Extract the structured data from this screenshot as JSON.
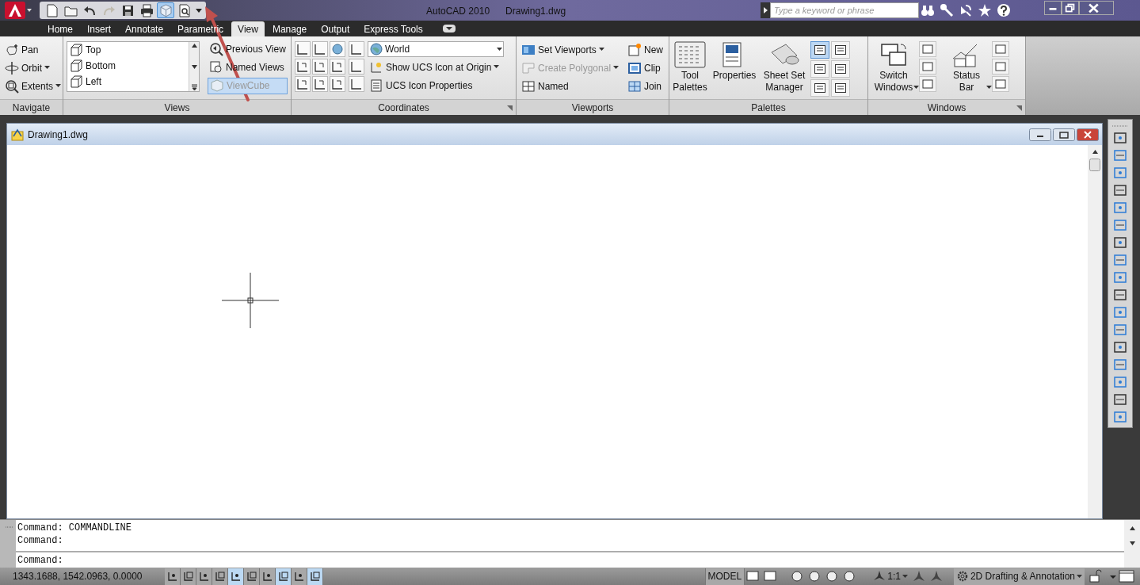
{
  "title_bar": {
    "app_title": "AutoCAD 2010",
    "document": "Drawing1.dwg",
    "search": {
      "placeholder": "Type a keyword or phrase"
    }
  },
  "quick_access": [
    {
      "kind": "new",
      "selected": false,
      "disabled": false
    },
    {
      "kind": "open",
      "selected": false,
      "disabled": false
    },
    {
      "kind": "undo",
      "selected": false,
      "disabled": false
    },
    {
      "kind": "redo",
      "selected": false,
      "disabled": true
    },
    {
      "kind": "save",
      "selected": false,
      "disabled": false
    },
    {
      "kind": "print",
      "selected": false,
      "disabled": false
    },
    {
      "kind": "cube",
      "selected": true,
      "disabled": false
    },
    {
      "kind": "preview",
      "selected": false,
      "disabled": false
    }
  ],
  "ribbon_tabs": [
    {
      "label": "Home",
      "selected": false
    },
    {
      "label": "Insert",
      "selected": false
    },
    {
      "label": "Annotate",
      "selected": false
    },
    {
      "label": "Parametric",
      "selected": false
    },
    {
      "label": "View",
      "selected": true
    },
    {
      "label": "Manage",
      "selected": false
    },
    {
      "label": "Output",
      "selected": false
    },
    {
      "label": "Express Tools",
      "selected": false
    }
  ],
  "navigate": {
    "title": "Navigate",
    "items": [
      {
        "label": "Pan",
        "dropdown": false
      },
      {
        "label": "Orbit",
        "dropdown": true
      },
      {
        "label": "Extents",
        "dropdown": true
      }
    ]
  },
  "views": {
    "title": "Views",
    "list": [
      "Top",
      "Bottom",
      "Left"
    ],
    "items": [
      {
        "label": "Previous View",
        "selected": false,
        "disabled": false
      },
      {
        "label": "Named Views",
        "selected": false,
        "disabled": false
      },
      {
        "label": "ViewCube",
        "selected": true,
        "disabled": true
      }
    ]
  },
  "coordinates": {
    "title": "Coordinates",
    "ucs": "World",
    "items": [
      {
        "label": "Show UCS Icon at Origin",
        "dropdown": true
      },
      {
        "label": "UCS Icon Properties",
        "dropdown": false
      }
    ]
  },
  "viewports": {
    "title": "Viewports",
    "items": [
      {
        "label": "Set Viewports",
        "dropdown": true,
        "disabled": false
      },
      {
        "label": "Create Polygonal",
        "dropdown": true,
        "disabled": true
      },
      {
        "label": "Named",
        "dropdown": false,
        "disabled": false
      }
    ],
    "side_items": [
      "New",
      "Clip",
      "Join"
    ]
  },
  "palettes": {
    "title": "Palettes",
    "large": [
      "Tool Palettes",
      "Properties",
      "Sheet Set Manager"
    ],
    "toggles": [
      {
        "selected": true
      },
      {
        "selected": false
      },
      {
        "selected": false
      },
      {
        "selected": false
      },
      {
        "selected": false
      },
      {
        "selected": false
      }
    ]
  },
  "windows": {
    "title": "Windows",
    "large": [
      {
        "label": "Switch Windows",
        "dropdown": true
      },
      {
        "label": "Status Bar",
        "dropdown": true
      }
    ]
  },
  "document": {
    "title": "Drawing1.dwg"
  },
  "command_line": {
    "history": [
      "Command: COMMANDLINE",
      "Command:"
    ],
    "prompt": "Command:"
  },
  "status_bar": {
    "coordinates": "1343.1688, 1542.0963, 0.0000",
    "toggles": [
      {
        "selected": false
      },
      {
        "selected": false
      },
      {
        "selected": false
      },
      {
        "selected": false
      },
      {
        "selected": true
      },
      {
        "selected": false
      },
      {
        "selected": false
      },
      {
        "selected": true
      },
      {
        "selected": false
      },
      {
        "selected": true
      }
    ],
    "space": "MODEL",
    "annotation_scale": "1:1",
    "workspace": "2D Drafting & Annotation"
  }
}
